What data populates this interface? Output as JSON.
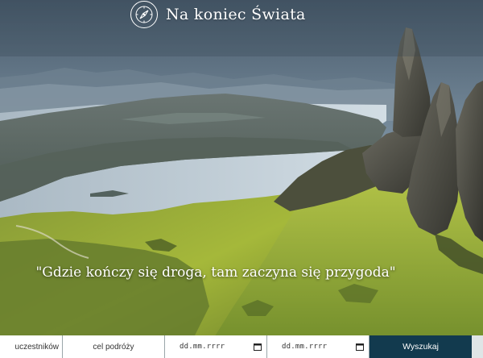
{
  "header": {
    "logo_icon": "compass-icon",
    "title": "Na koniec Świata"
  },
  "hero": {
    "tagline": "\"Gdzie kończy się droga, tam zaczyna się przygoda\""
  },
  "search": {
    "participants_placeholder": "uczestników",
    "destination_placeholder": "cel podróży",
    "date_from_placeholder": "dd.mm.rrrr",
    "date_to_placeholder": "dd.mm.rrrr",
    "calendar_icon": "calendar-icon",
    "submit_label": "Wyszukaj"
  },
  "colors": {
    "button": "#123a4e",
    "field": "#ffffff",
    "title_text": "#ffffff"
  }
}
